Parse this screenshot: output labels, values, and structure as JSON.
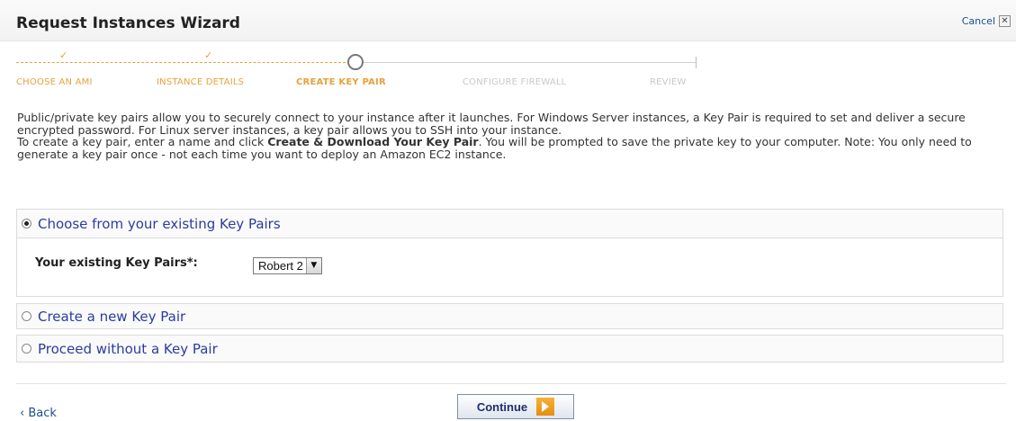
{
  "header": {
    "title": "Request Instances Wizard",
    "cancel_label": "Cancel",
    "cancel_icon": "close-icon"
  },
  "steps": [
    {
      "label": "CHOOSE AN AMI",
      "state": "done"
    },
    {
      "label": "INSTANCE DETAILS",
      "state": "done"
    },
    {
      "label": "CREATE KEY PAIR",
      "state": "current"
    },
    {
      "label": "CONFIGURE FIREWALL",
      "state": "todo"
    },
    {
      "label": "REVIEW",
      "state": "todo"
    }
  ],
  "intro": {
    "p1": "Public/private key pairs allow you to securely connect to your instance after it launches. For Windows Server instances, a Key Pair is required to set and deliver a secure encrypted password. For Linux server instances, a key pair allows you to SSH into your instance.",
    "p2_before": "To create a key pair, enter a name and click ",
    "p2_bold": "Create & Download Your Key Pair",
    "p2_after": ". You will be prompted to save the private key to your computer. Note: You only need to generate a key pair once - not each time you want to deploy an Amazon EC2 instance."
  },
  "options": {
    "existing": {
      "label": "Choose from your existing Key Pairs",
      "selected": true
    },
    "create": {
      "label": "Create a new Key Pair",
      "selected": false
    },
    "none": {
      "label": "Proceed without a Key Pair",
      "selected": false
    }
  },
  "key_pairs": {
    "label": "Your existing Key Pairs*:",
    "selected": "Robert 2"
  },
  "footer": {
    "back_label": "‹ Back",
    "continue_label": "Continue"
  },
  "colors": {
    "accent_orange": "#e6a23c",
    "link_blue": "#1b4f8c",
    "option_blue": "#2a3d9e"
  }
}
